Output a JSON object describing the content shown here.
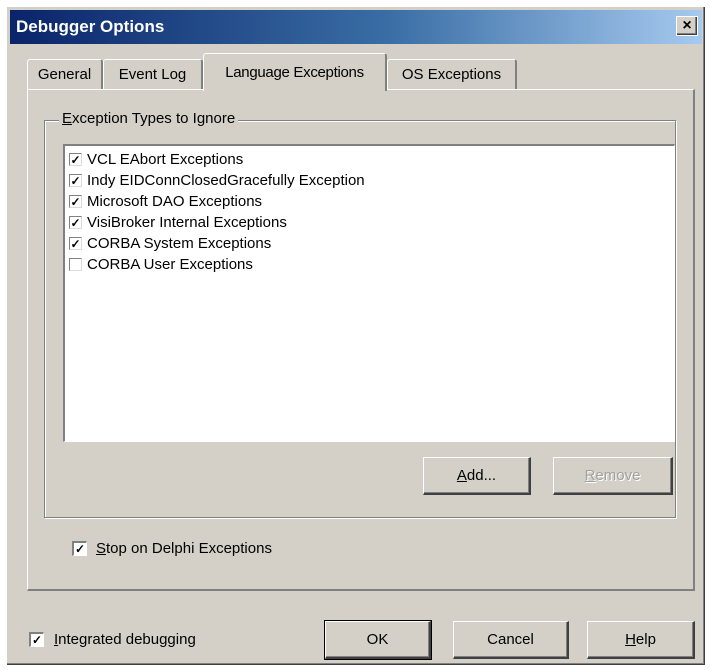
{
  "window": {
    "title": "Debugger Options",
    "close_glyph": "×"
  },
  "tabs": [
    {
      "label": "General"
    },
    {
      "label": "Event Log"
    },
    {
      "label": "Language Exceptions"
    },
    {
      "label": "OS Exceptions"
    }
  ],
  "group": {
    "label_first": "E",
    "label_rest": "xception Types to Ignore",
    "items": [
      {
        "label": "VCL EAbort Exceptions",
        "checked": true
      },
      {
        "label": "Indy EIDConnClosedGracefully Exception",
        "checked": true
      },
      {
        "label": "Microsoft DAO Exceptions",
        "checked": true
      },
      {
        "label": "VisiBroker Internal Exceptions",
        "checked": true
      },
      {
        "label": "CORBA System Exceptions",
        "checked": true
      },
      {
        "label": "CORBA User Exceptions",
        "checked": false
      }
    ],
    "add_first": "A",
    "add_rest": "dd...",
    "remove_first": "R",
    "remove_rest": "emove"
  },
  "stop_on_delphi": {
    "first": "S",
    "rest": "top on Delphi Exceptions",
    "checked": true
  },
  "integrated": {
    "first": "I",
    "rest": "ntegrated debugging",
    "checked": true
  },
  "buttons": {
    "ok": "OK",
    "cancel": "Cancel",
    "help_first": "H",
    "help_rest": "elp"
  },
  "glyphs": {
    "check": "✓"
  },
  "icons": {
    "close": "close-icon",
    "check": "checkmark-icon"
  }
}
